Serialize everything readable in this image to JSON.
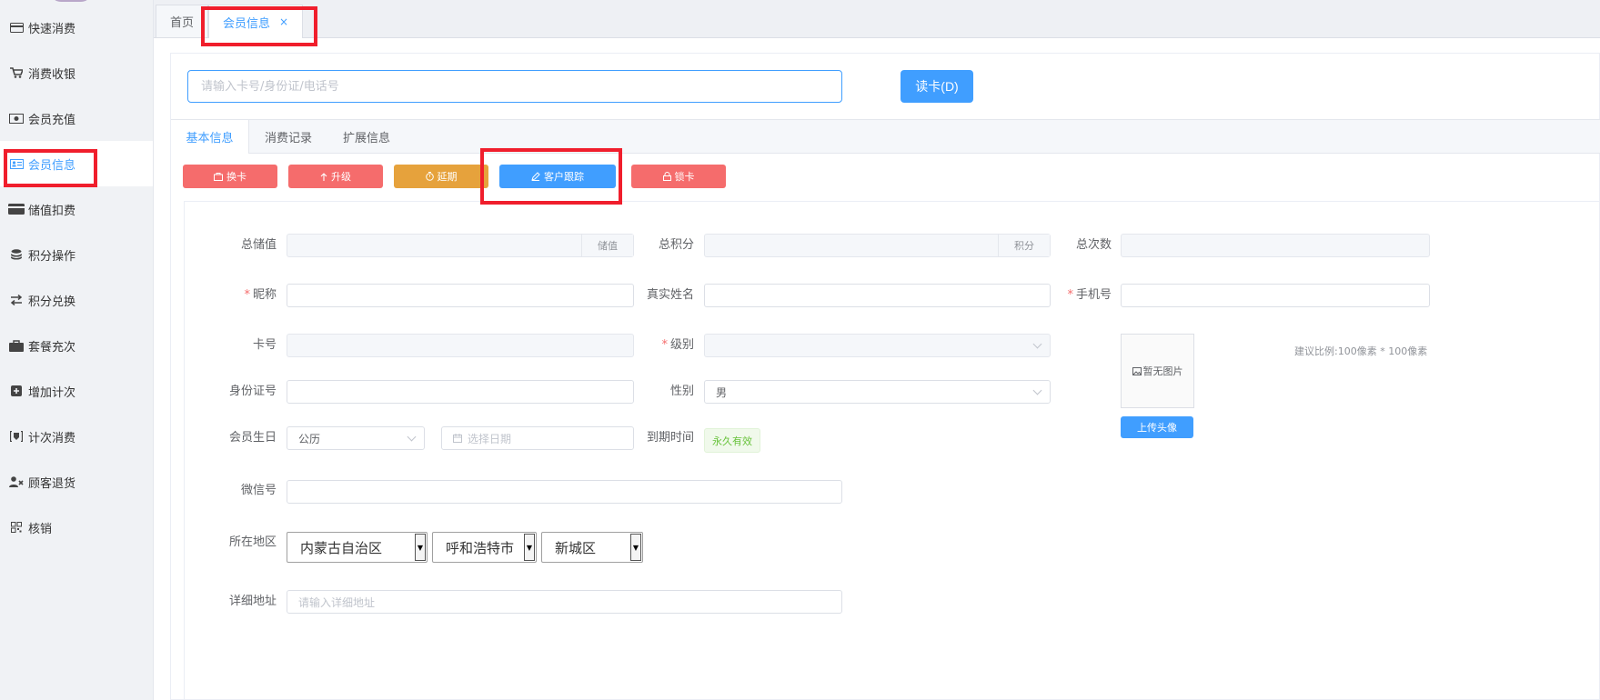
{
  "sidebar": {
    "items": [
      {
        "label": "快速消费",
        "icon": "card-icon"
      },
      {
        "label": "消费收银",
        "icon": "cart-icon"
      },
      {
        "label": "会员充值",
        "icon": "money-icon"
      },
      {
        "label": "会员信息",
        "icon": "id-card-icon"
      },
      {
        "label": "储值扣费",
        "icon": "credit-card-icon"
      },
      {
        "label": "积分操作",
        "icon": "coins-icon"
      },
      {
        "label": "积分兑换",
        "icon": "exchange-icon"
      },
      {
        "label": "套餐充次",
        "icon": "briefcase-icon"
      },
      {
        "label": "增加计次",
        "icon": "plus-square-icon"
      },
      {
        "label": "计次消费",
        "icon": "badge-icon"
      },
      {
        "label": "顾客退货",
        "icon": "user-remove-icon"
      },
      {
        "label": "核销",
        "icon": "qrcode-icon"
      }
    ]
  },
  "tabs": {
    "home": "首页",
    "member": "会员信息",
    "close": "×"
  },
  "search": {
    "placeholder": "请输入卡号/身份证/电话号",
    "read_card": "读卡(D)"
  },
  "subtabs": {
    "basic": "基本信息",
    "records": "消费记录",
    "extended": "扩展信息"
  },
  "actions": {
    "change_card": "换卡",
    "upgrade": "升级",
    "extend": "延期",
    "follow_up": "客户跟踪",
    "lock": "锁卡"
  },
  "form": {
    "total_balance": "总储值",
    "balance_unit": "储值",
    "total_points": "总积分",
    "points_unit": "积分",
    "total_times": "总次数",
    "nickname": "昵称",
    "real_name": "真实姓名",
    "phone": "手机号",
    "card_no": "卡号",
    "level": "级别",
    "id_no": "身份证号",
    "gender": "性别",
    "gender_value": "男",
    "birthday": "会员生日",
    "calendar_type": "公历",
    "date_placeholder": "选择日期",
    "expire": "到期时间",
    "expire_value": "永久有效",
    "wechat": "微信号",
    "region": "所在地区",
    "province": "内蒙古自治区",
    "city": "呼和浩特市",
    "district": "新城区",
    "address": "详细地址",
    "address_placeholder": "请输入详细地址",
    "required_mark": "*"
  },
  "avatar": {
    "no_image": "暂无图片",
    "upload": "上传头像",
    "hint": "建议比例:100像素 * 100像素"
  },
  "colors": {
    "primary": "#409eff",
    "danger": "#f56c6c",
    "warning": "#e6a23c",
    "success": "#67c23a",
    "highlight": "#f01e2c"
  }
}
